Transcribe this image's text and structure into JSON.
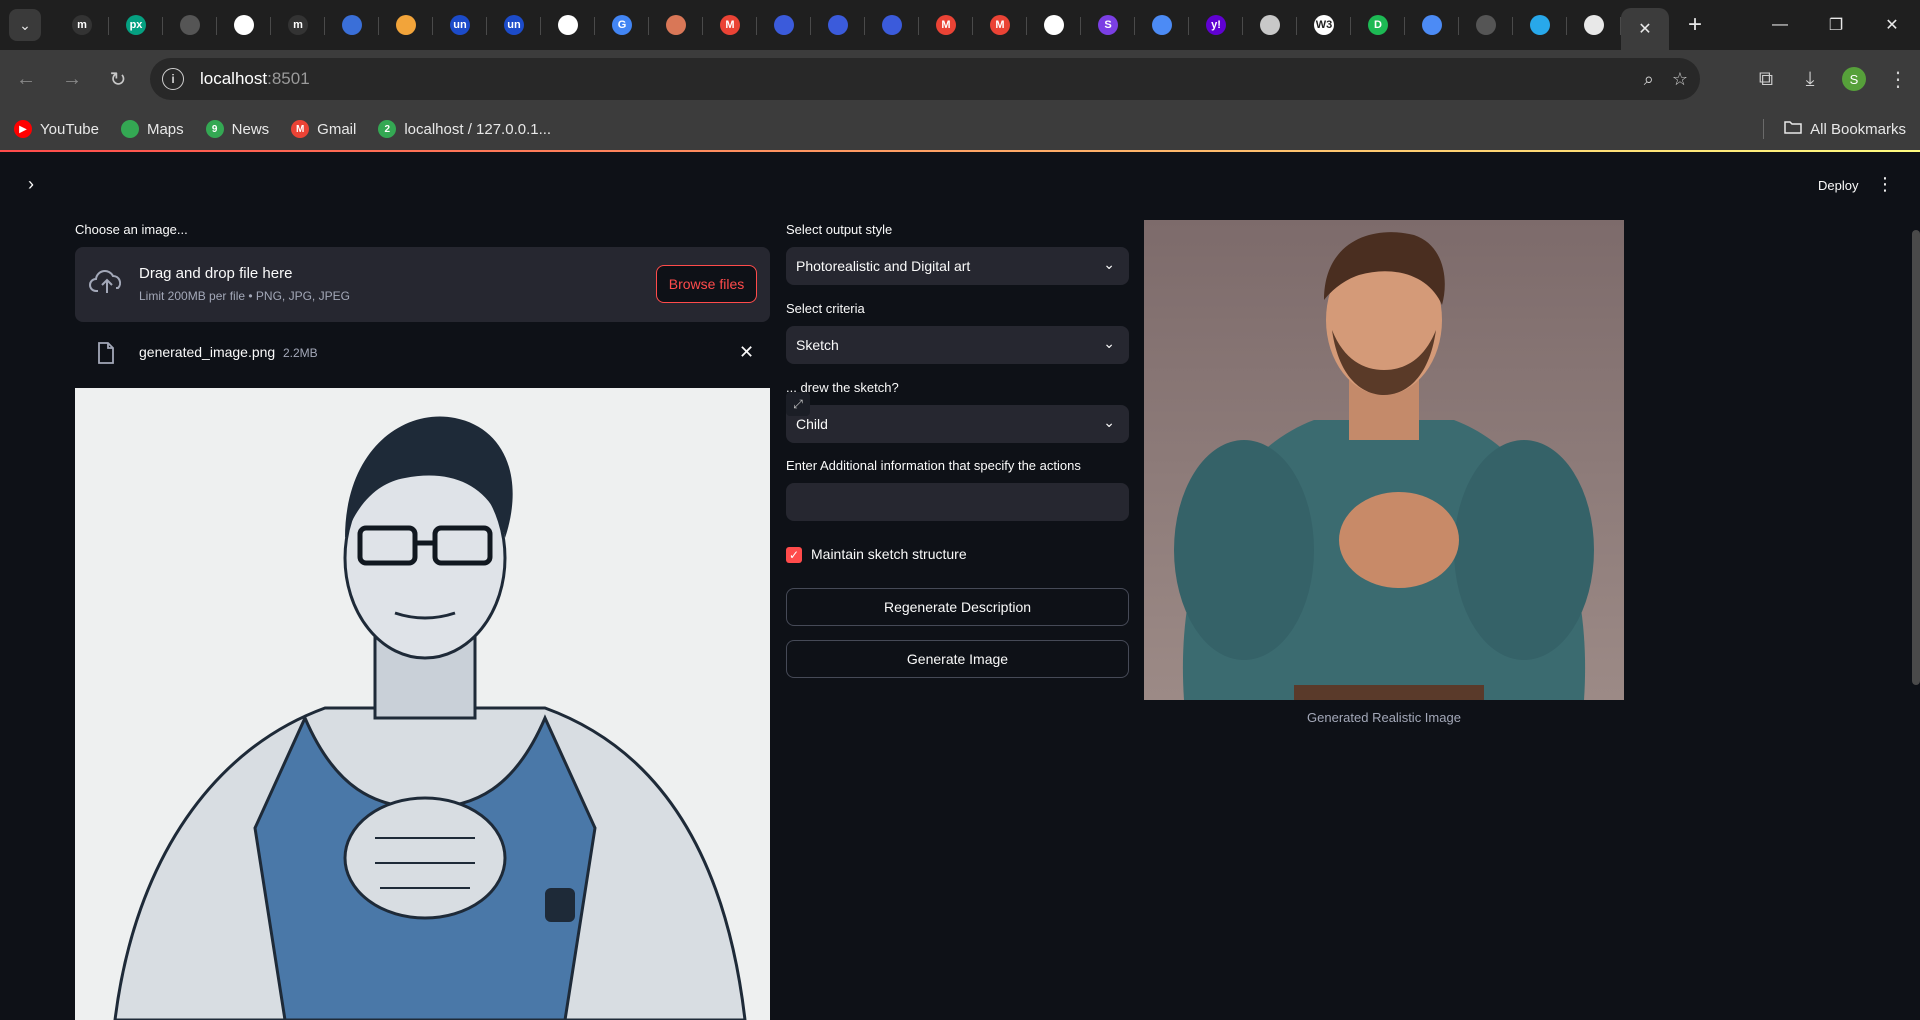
{
  "browser": {
    "tabs": [
      {
        "icon": "medium-icon",
        "letter": "m",
        "color": "#333333"
      },
      {
        "icon": "pexels-icon",
        "letter": "px",
        "color": "#05a081"
      },
      {
        "icon": "generic-icon",
        "letter": "",
        "color": "#555555"
      },
      {
        "icon": "openai-icon",
        "letter": "",
        "color": "#ffffff"
      },
      {
        "icon": "medium-icon",
        "letter": "m",
        "color": "#333333"
      },
      {
        "icon": "app-icon",
        "letter": "",
        "color": "#3a6fd8"
      },
      {
        "icon": "cloud-icon",
        "letter": "",
        "color": "#f2a43a"
      },
      {
        "icon": "unstop-icon",
        "letter": "un",
        "color": "#1c4bc9"
      },
      {
        "icon": "unstop-icon",
        "letter": "un",
        "color": "#1c4bc9"
      },
      {
        "icon": "github-icon",
        "letter": "",
        "color": "#ffffff"
      },
      {
        "icon": "google-icon",
        "letter": "G",
        "color": "#4285f4"
      },
      {
        "icon": "claude-icon",
        "letter": "",
        "color": "#d97757"
      },
      {
        "icon": "gmail-icon",
        "letter": "M",
        "color": "#ea4335"
      },
      {
        "icon": "kotlin-icon",
        "letter": "",
        "color": "#3b5bdb"
      },
      {
        "icon": "kotlin-icon",
        "letter": "",
        "color": "#3b5bdb"
      },
      {
        "icon": "kotlin-icon",
        "letter": "",
        "color": "#3b5bdb"
      },
      {
        "icon": "gmail-icon",
        "letter": "M",
        "color": "#ea4335"
      },
      {
        "icon": "gmail-icon",
        "letter": "M",
        "color": "#ea4335"
      },
      {
        "icon": "github-icon",
        "letter": "",
        "color": "#ffffff"
      },
      {
        "icon": "s-icon",
        "letter": "S",
        "color": "#7b3fe4"
      },
      {
        "icon": "docs-icon",
        "letter": "",
        "color": "#4c8bf5"
      },
      {
        "icon": "yahoo-icon",
        "letter": "y!",
        "color": "#6001d2"
      },
      {
        "icon": "globe-icon",
        "letter": "",
        "color": "#c8c8c8"
      },
      {
        "icon": "w3schools-icon",
        "letter": "W3",
        "color": "#ffffff"
      },
      {
        "icon": "d-icon",
        "letter": "D",
        "color": "#1db954"
      },
      {
        "icon": "docs-icon",
        "letter": "",
        "color": "#4c8bf5"
      },
      {
        "icon": "generic-icon",
        "letter": "",
        "color": "#555555"
      },
      {
        "icon": "onedrive-icon",
        "letter": "",
        "color": "#28a8ea"
      },
      {
        "icon": "crown-icon",
        "letter": "",
        "color": "#e8e8e8"
      }
    ],
    "url_host": "localhost",
    "url_port": ":8501",
    "bookmarks": [
      {
        "label": "YouTube",
        "icon": "youtube-icon",
        "color": "#ff0000",
        "letter": "▶"
      },
      {
        "label": "Maps",
        "icon": "maps-icon",
        "color": "#34a853",
        "letter": ""
      },
      {
        "label": "News",
        "icon": "news-icon",
        "color": "#34a853",
        "letter": "9"
      },
      {
        "label": "Gmail",
        "icon": "gmail-icon",
        "color": "#ea4335",
        "letter": "M"
      },
      {
        "label": "localhost / 127.0.0.1...",
        "icon": "phpmyadmin-icon",
        "color": "#34a853",
        "letter": "2"
      }
    ],
    "all_bookmarks": "All Bookmarks",
    "profile_letter": "S"
  },
  "app": {
    "deploy_label": "Deploy",
    "uploader": {
      "label": "Choose an image...",
      "title": "Drag and drop file here",
      "subtitle": "Limit 200MB per file • PNG, JPG, JPEG",
      "browse_label": "Browse files",
      "file_name": "generated_image.png",
      "file_size": "2.2MB"
    },
    "output_style": {
      "label": "Select output style",
      "value": "Photorealistic and Digital art"
    },
    "criteria": {
      "label": "Select criteria",
      "value": "Sketch"
    },
    "drawer": {
      "label": "... drew the sketch?",
      "value": "Child"
    },
    "additional": {
      "label": "Enter Additional information that specify the actions",
      "value": ""
    },
    "maintain_label": "Maintain sketch structure",
    "regen_label": "Regenerate Description",
    "generate_label": "Generate Image",
    "result_caption": "Generated Realistic Image",
    "colors": {
      "accent": "#ff4b4b",
      "bg": "#0e1117",
      "widget": "#262730"
    }
  }
}
